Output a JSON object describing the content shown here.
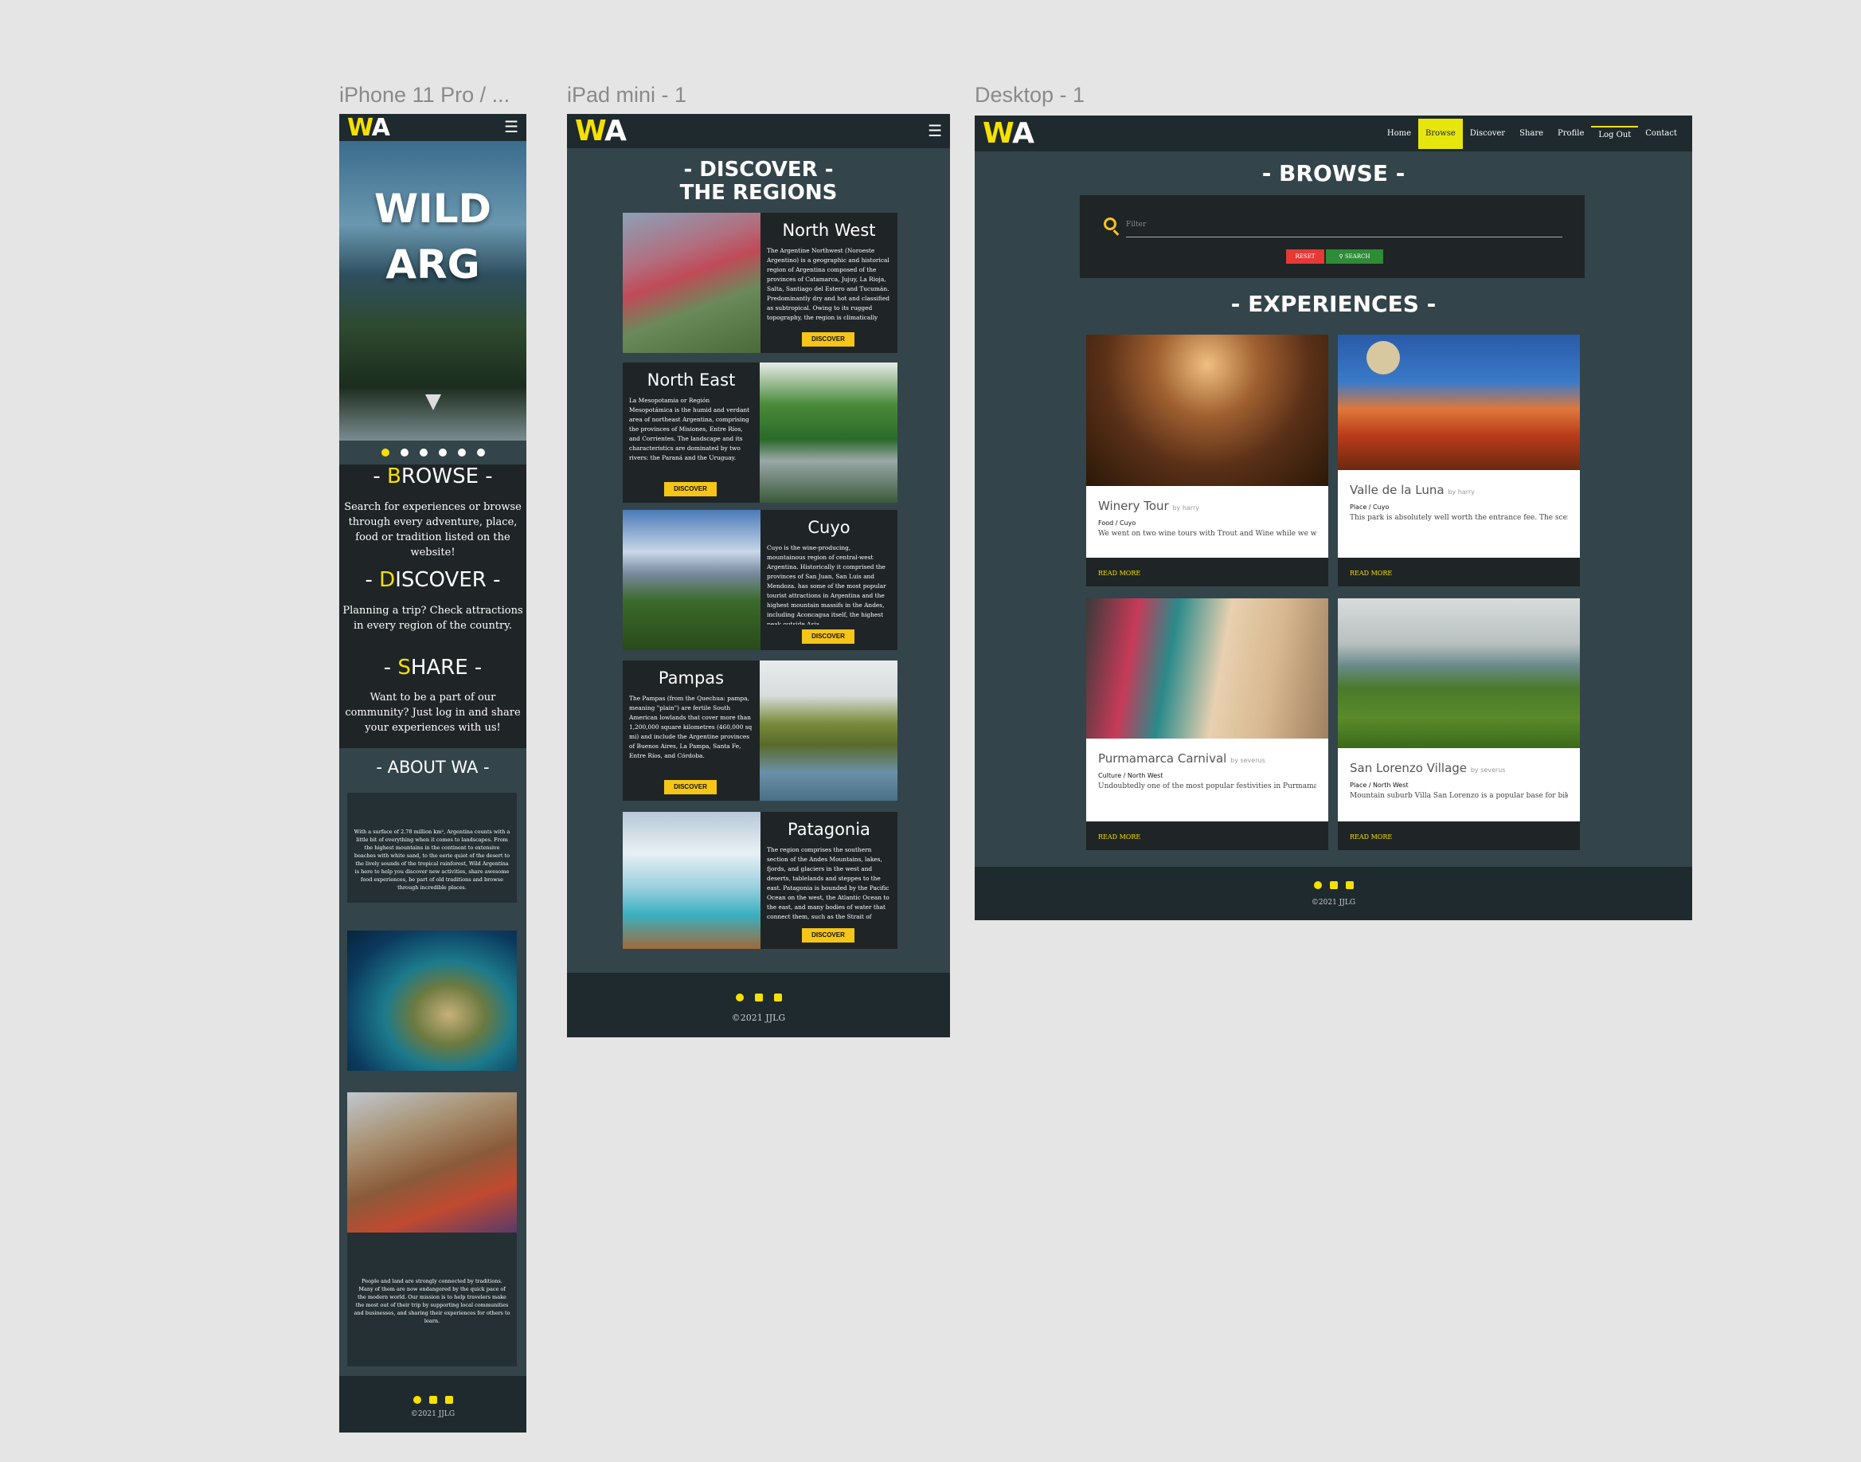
{
  "frames": {
    "iphone_label": "iPhone 11 Pro / ...",
    "ipad_label": "iPad mini - 1",
    "desktop_label": "Desktop - 1"
  },
  "brand": {
    "logo_w": "W",
    "logo_a": "A"
  },
  "colors": {
    "accent": "#f5e100",
    "background": "#33444a",
    "panel": "#1f2426",
    "button": "#f5c518"
  },
  "iphone": {
    "hero_line1": "WILD",
    "hero_line2": "ARG",
    "carousel_count": 6,
    "carousel_active": 1,
    "browse": {
      "dash_left": "- ",
      "initial": "B",
      "rest": "ROWSE",
      "dash_right": " -",
      "text": "Search for experiences or browse through every adventure, place, food or tradition listed on the website!"
    },
    "discover": {
      "dash_left": "- ",
      "initial": "D",
      "rest": "ISCOVER",
      "dash_right": " -",
      "text": "Planning a trip? Check attractions in every region of the country."
    },
    "share": {
      "dash_left": "- ",
      "initial": "S",
      "rest": "HARE",
      "dash_right": " -",
      "text": "Want to be a part of our community? Just log in and share your experiences with us!"
    },
    "about_title": "- ABOUT WA -",
    "about_text_1": "With a surface of 2.78 million km², Argentina counts with a little bit of everything when it comes to landscapes. From the highest mountains in the continent to extensive beaches with white sand, to the eerie quiet of the desert to the lively sounds of the tropical rainforest, Wild Argentina is here to help you discover new activities, share awesome food experiences, be part of old traditions and browse through incredible places.",
    "about_text_2": "People and land are strongly connected by traditions. Many of them are now endangered by the quick pace of the modern world. Our mission is to help travelers make the most out of their trip by supporting local communities and businesses, and sharing their experiences for others to learn.",
    "copyright": "©2021 JJLG"
  },
  "ipad": {
    "title_line1": "- DISCOVER -",
    "title_line2": "THE REGIONS",
    "regions": [
      {
        "name": "North West",
        "text": "The Argentine Northwest (Noroeste Argentino) is a geographic and historical region of Argentina composed of the provinces of Catamarca, Jujuy, La Rioja, Salta, Santiago del Estero and Tucumán. Predominantly dry and hot and classified as subtropical. Owing to its rugged topography, the region is climatically",
        "button": "DISCOVER"
      },
      {
        "name": "North East",
        "text": "La Mesopotamia or Región Mesopotámica is the humid and verdant area of northeast Argentina, comprising the provinces of Misiones, Entre Ríos, and Corrientes. The landscape and its characteristics are dominated by two rivers: the Paraná and the Uruguay.",
        "button": "DISCOVER"
      },
      {
        "name": "Cuyo",
        "text": "Cuyo is the wine-producing, mountainous region of central-west Argentina. Historically it comprised the provinces of San Juan, San Luis and Mendoza. has some of the most popular tourist attractions in Argentina and the highest mountain massifs in the Andes, including Aconcagua itself, the highest peak outside Asia.",
        "button": "DISCOVER"
      },
      {
        "name": "Pampas",
        "text": "The Pampas (from the Quechua: pampa, meaning \"plain\") are fertile South American lowlands that cover more than 1,200,000 square kilometres (460,000 sq mi) and include the Argentine provinces of Buenos Aires, La Pampa, Santa Fe, Entre Ríos, and Córdoba.",
        "button": "DISCOVER"
      },
      {
        "name": "Patagonia",
        "text": "The region comprises the southern section of the Andes Mountains, lakes, fjords, and glaciers in the west and deserts, tablelands and steppes to the east. Patagonia is bounded by the Pacific Ocean on the west, the Atlantic Ocean to the east, and many bodies of water that connect them, such as the Strait of",
        "button": "DISCOVER"
      }
    ],
    "copyright": "©2021 JJLG"
  },
  "desktop": {
    "nav": [
      "Home",
      "Browse",
      "Discover",
      "Share",
      "Profile",
      "Log Out",
      "Contact"
    ],
    "nav_active": "Browse",
    "browse_title": "- BROWSE -",
    "filter_placeholder": "Filter",
    "reset_label": "RESET",
    "search_label": "SEARCH",
    "experiences_title": "- EXPERIENCES -",
    "cards": [
      {
        "title": "Winery Tour",
        "by": "by harry",
        "category": "Food / Cuyo",
        "desc": "We went on two wine tours with Trout and Wine while we were",
        "read": "READ MORE"
      },
      {
        "title": "Valle de la Luna",
        "by": "by harry",
        "category": "Place / Cuyo",
        "desc": "This park is absolutely well worth the entrance fee. The scenery",
        "read": "READ MORE"
      },
      {
        "title": "Purmamarca Carnival",
        "by": "by severus",
        "category": "Culture / North West",
        "desc": "Undoubtedly one of the most popular festivities in Purmamarca",
        "read": "READ MORE"
      },
      {
        "title": "San Lorenzo Village",
        "by": "by severus",
        "category": "Place / North West",
        "desc": "Mountain suburb Villa San Lorenzo is a popular base for bikes",
        "read": "READ MORE"
      }
    ],
    "copyright": "©2021 JJLG"
  }
}
